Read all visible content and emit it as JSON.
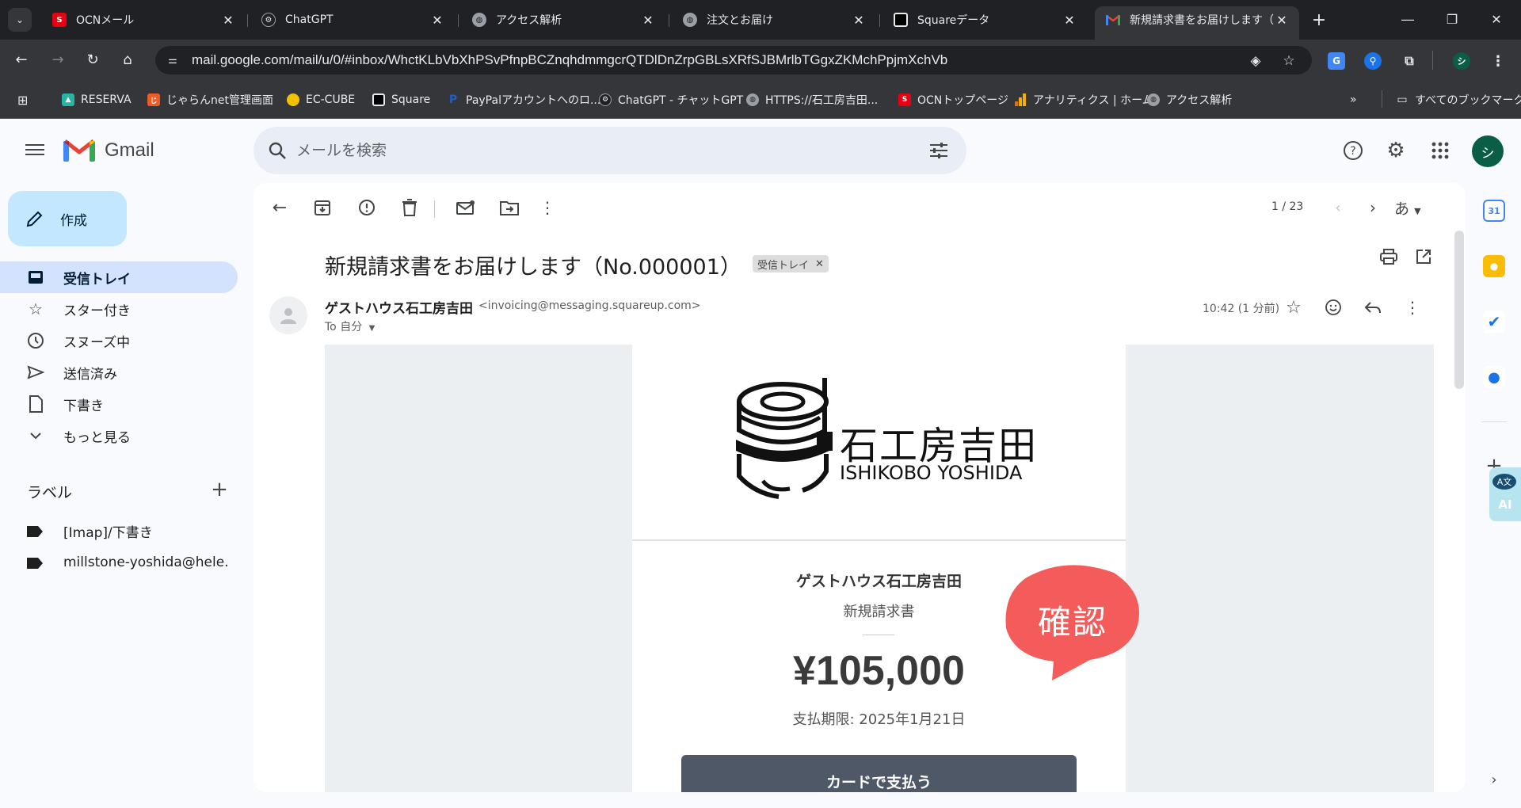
{
  "browser": {
    "tabs": [
      {
        "title": "OCNメール",
        "icon": "ocn-icon",
        "color": "#e60012",
        "active": false
      },
      {
        "title": "ChatGPT",
        "icon": "chatgpt-icon",
        "color": "#202124",
        "active": false
      },
      {
        "title": "アクセス解析",
        "icon": "globe-icon",
        "color": "#9aa0a6",
        "active": false
      },
      {
        "title": "注文とお届け",
        "icon": "globe-icon",
        "color": "#9aa0a6",
        "active": false
      },
      {
        "title": "Squareデータ",
        "icon": "square-icon",
        "color": "#000000",
        "active": false
      },
      {
        "title": "新規請求書をお届けします（",
        "icon": "gmail-icon",
        "color": "#ea4335",
        "active": true
      }
    ],
    "url": "mail.google.com/mail/u/0/#inbox/WhctKLbVbXhPSvPfnpBCZnqhdmmgcrQTDlDnZrpGBLsXRfSJBMrlbTGgxZKMchPpjmXchVb",
    "bookmarks": [
      {
        "label": "RESERVA",
        "icon": "reserva-icon",
        "color": "#26b5a4"
      },
      {
        "label": "じゃらんnet管理画面",
        "icon": "jalan-icon",
        "color": "#f05a24"
      },
      {
        "label": "EC-CUBE",
        "icon": "eccube-icon",
        "color": "#f2c100"
      },
      {
        "label": "Square",
        "icon": "square-icon",
        "color": "#000000"
      },
      {
        "label": "PayPalアカウントへのロ...",
        "icon": "paypal-icon",
        "color": "#1f5fbf"
      },
      {
        "label": "ChatGPT - チャットGPT",
        "icon": "chatgpt-icon",
        "color": "#202124"
      },
      {
        "label": "HTTPS://石工房吉田...",
        "icon": "globe-icon",
        "color": "#9aa0a6"
      },
      {
        "label": "OCNトップページ",
        "icon": "ocn-icon",
        "color": "#e60012"
      },
      {
        "label": "アナリティクス | ホーム",
        "icon": "analytics-icon",
        "color": "#f9ab00"
      },
      {
        "label": "アクセス解析",
        "icon": "globe-icon",
        "color": "#9aa0a6"
      }
    ],
    "all_bookmarks": "すべてのブックマーク"
  },
  "gmail": {
    "brand": "Gmail",
    "search_placeholder": "メールを検索",
    "compose": "作成",
    "nav": [
      {
        "label": "受信トレイ",
        "icon": "inbox-icon",
        "active": true
      },
      {
        "label": "スター付き",
        "icon": "star-icon",
        "active": false
      },
      {
        "label": "スヌーズ中",
        "icon": "clock-icon",
        "active": false
      },
      {
        "label": "送信済み",
        "icon": "send-icon",
        "active": false
      },
      {
        "label": "下書き",
        "icon": "draft-icon",
        "active": false
      },
      {
        "label": "もっと見る",
        "icon": "chevron-down-icon",
        "active": false
      }
    ],
    "labels_title": "ラベル",
    "labels": [
      {
        "label": "[Imap]/下書き"
      },
      {
        "label": "millstone-yoshida@hele..."
      }
    ],
    "account_initial": "シ"
  },
  "message": {
    "pager": "1 / 23",
    "input_tool": "あ",
    "subject": "新規請求書をお届けします（No.000001）",
    "chip": "受信トレイ",
    "sender_name": "ゲストハウス石工房吉田",
    "sender_email": "<invoicing@messaging.squareup.com>",
    "to": "To 自分",
    "time": "10:42 (1 分前)"
  },
  "invoice": {
    "logo_jp": "石工房吉田",
    "logo_en": "ISHIKOBO YOSHIDA",
    "business_name": "ゲストハウス石工房吉田",
    "doc_label": "新規請求書",
    "amount": "¥105,000",
    "due": "支払期限: 2025年1月21日",
    "pay_button": "カードで支払う"
  },
  "overlay": {
    "confirm": "確認",
    "confirm_color": "#f45b5b",
    "ai_label": "AI",
    "ai_top": "A文"
  }
}
